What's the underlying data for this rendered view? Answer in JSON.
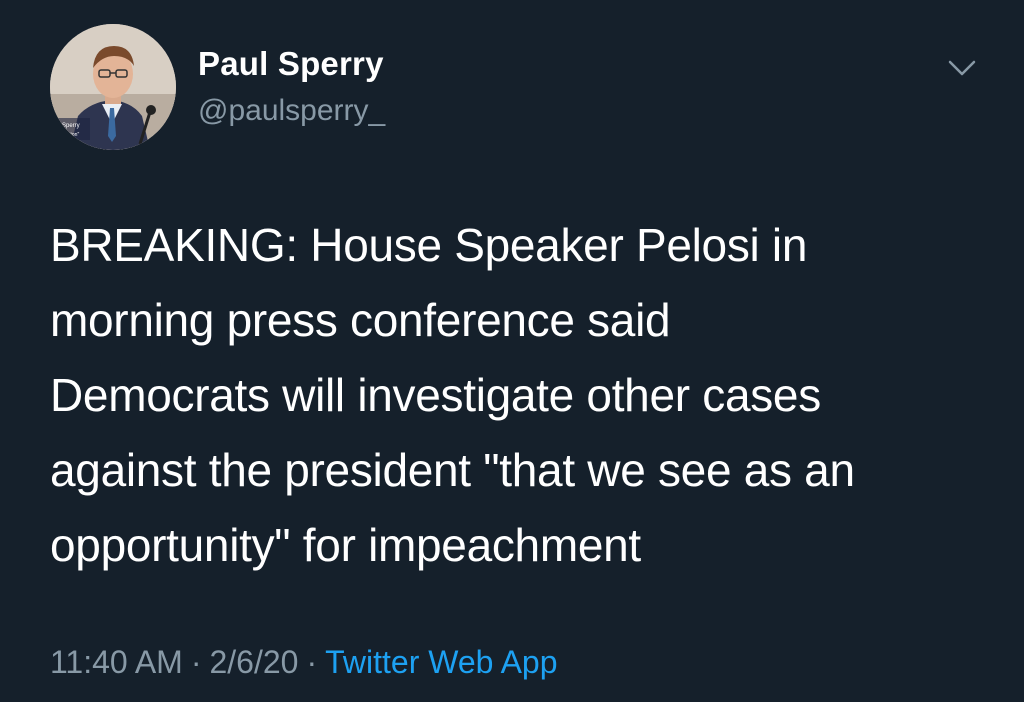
{
  "tweet": {
    "author": {
      "name": "Paul Sperry",
      "handle": "@paulsperry_",
      "avatar_caption_line1": "Sperry",
      "avatar_caption_line2": "\"Infiltration\""
    },
    "text": "BREAKING: House Speaker Pelosi in\nmorning press conference said\nDemocrats will investigate other cases\nagainst the president \"that we see as an\nopportunity\" for impeachment",
    "time": "11:40 AM",
    "separator": "·",
    "date": "2/6/20",
    "source": "Twitter Web App",
    "menu_icon": "chevron-down-icon"
  },
  "colors": {
    "background": "#15202b",
    "primary_text": "#ffffff",
    "secondary_text": "#8899a6",
    "link": "#1da1f2"
  }
}
